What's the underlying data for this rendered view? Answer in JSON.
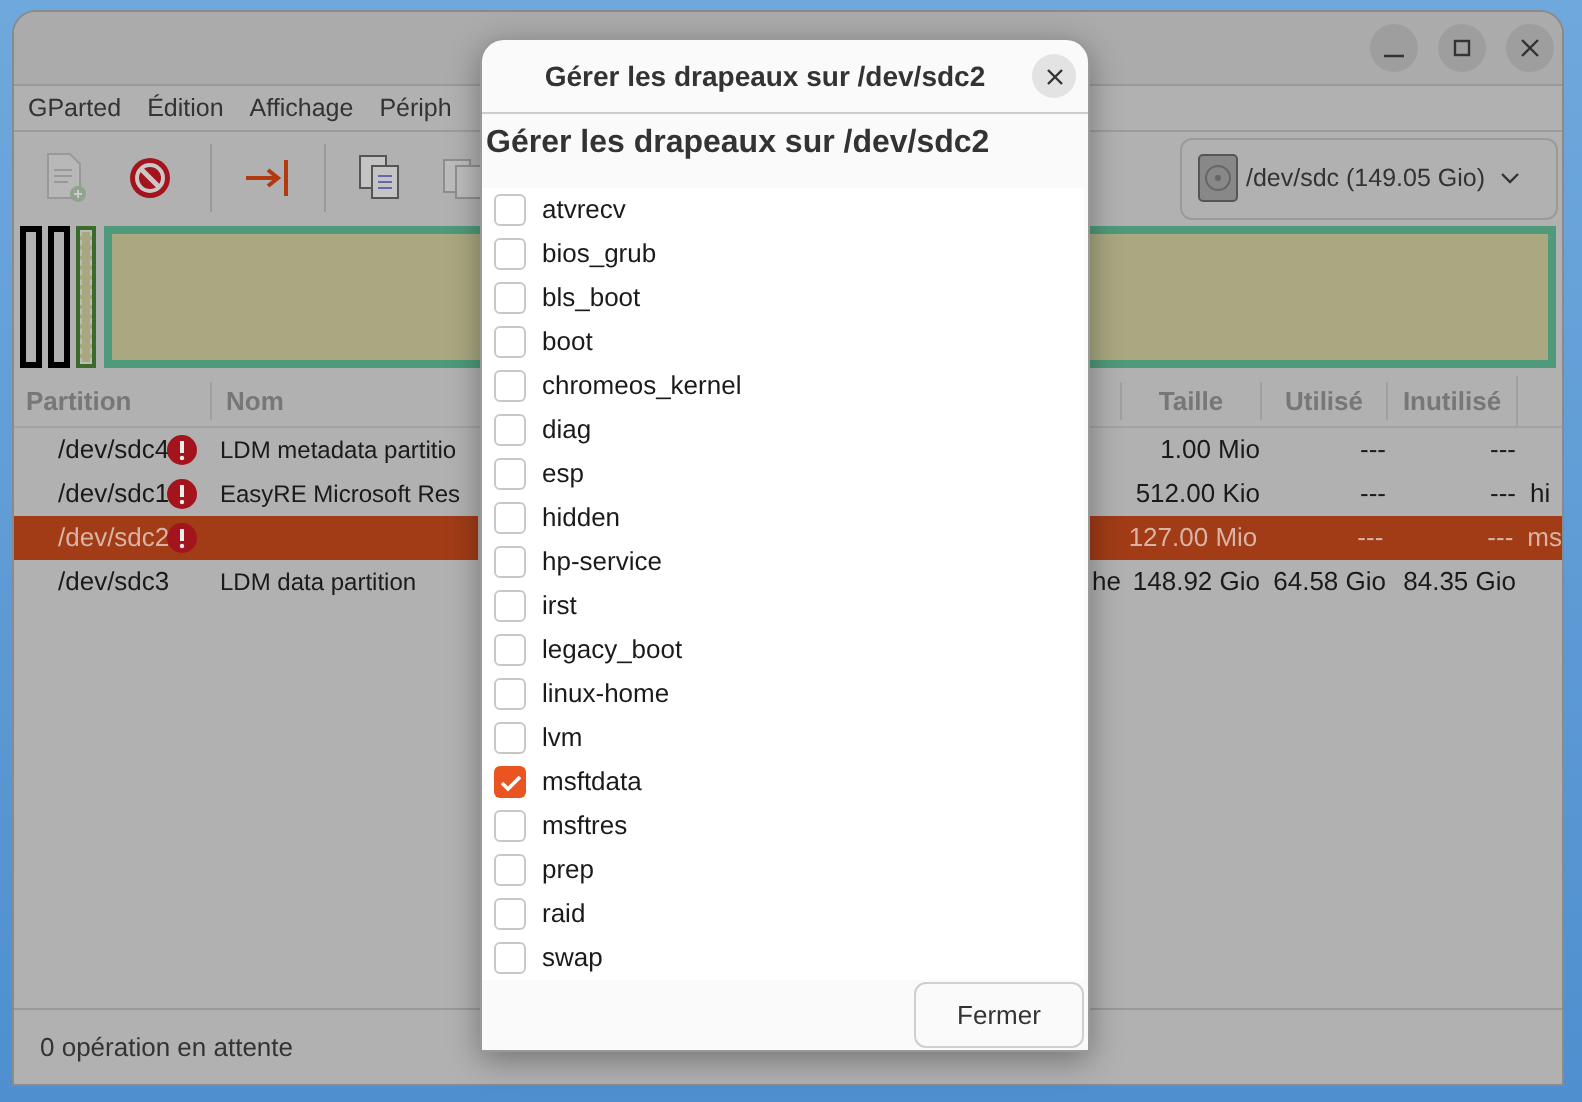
{
  "menu": [
    "GParted",
    "Édition",
    "Affichage",
    "Périph"
  ],
  "device_selector": {
    "label": "/dev/sdc (149.05 Gio)"
  },
  "table": {
    "columns": [
      "Partition",
      "Nom",
      "Taille",
      "Utilisé",
      "Inutilisé"
    ],
    "rows": [
      {
        "partition": "/dev/sdc4",
        "warning": true,
        "name": "LDM metadata partitio",
        "column_3": "",
        "size": "1.00 Mio",
        "used": "---",
        "unused": "---",
        "flags": "",
        "selected": false
      },
      {
        "partition": "/dev/sdc1",
        "warning": true,
        "name": "EasyRE Microsoft Res",
        "column_3": "",
        "size": "512.00 Kio",
        "used": "---",
        "unused": "---",
        "flags": "hi",
        "selected": false
      },
      {
        "partition": "/dev/sdc2",
        "warning": true,
        "name": "",
        "column_3": "",
        "size": "127.00 Mio",
        "used": "---",
        "unused": "---",
        "flags": "ms",
        "selected": true
      },
      {
        "partition": "/dev/sdc3",
        "warning": false,
        "name": "LDM data partition",
        "column_3": "he",
        "size": "148.92 Gio",
        "used": "64.58 Gio",
        "unused": "84.35 Gio",
        "flags": "",
        "selected": false
      }
    ]
  },
  "status_bar": "0 opération en attente",
  "dialog": {
    "title": "Gérer les drapeaux sur /dev/sdc2",
    "heading": "Gérer les drapeaux sur /dev/sdc2",
    "flags": [
      {
        "label": "atvrecv",
        "checked": false
      },
      {
        "label": "bios_grub",
        "checked": false
      },
      {
        "label": "bls_boot",
        "checked": false
      },
      {
        "label": "boot",
        "checked": false
      },
      {
        "label": "chromeos_kernel",
        "checked": false
      },
      {
        "label": "diag",
        "checked": false
      },
      {
        "label": "esp",
        "checked": false
      },
      {
        "label": "hidden",
        "checked": false
      },
      {
        "label": "hp-service",
        "checked": false
      },
      {
        "label": "irst",
        "checked": false
      },
      {
        "label": "legacy_boot",
        "checked": false
      },
      {
        "label": "linux-home",
        "checked": false
      },
      {
        "label": "lvm",
        "checked": false
      },
      {
        "label": "msftdata",
        "checked": true
      },
      {
        "label": "msftres",
        "checked": false
      },
      {
        "label": "prep",
        "checked": false
      },
      {
        "label": "raid",
        "checked": false
      },
      {
        "label": "swap",
        "checked": false
      }
    ],
    "close_button": "Fermer"
  }
}
